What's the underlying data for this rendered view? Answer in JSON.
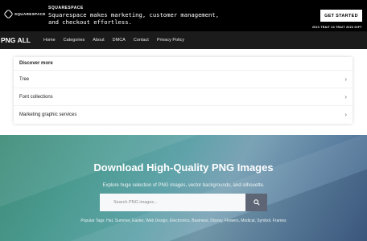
{
  "ad": {
    "logo_text": "SQUARESPACE",
    "brand": "SQUARESPACE",
    "message": "Squarespace makes marketing, customer management, and checkout effortless.",
    "cta": "GET STARTED",
    "footer": "2023 TRAIT 24 TRAIT 2023 GIFT"
  },
  "nav": {
    "site_title": "PNG ALL",
    "links": [
      "Home",
      "Categories",
      "About",
      "DMCA",
      "Contact",
      "Privacy Policy"
    ]
  },
  "discover": {
    "heading": "Discover more",
    "items": [
      "Tree",
      "Font collections",
      "Marketing graphic services"
    ]
  },
  "hero": {
    "title": "Download High-Quality PNG Images",
    "subtitle": "Explore huge selection of PNG images, vector backgrounds, and silhouette.",
    "search_placeholder": "Search PNG images...",
    "popular_tags": "Popular Tags: Hat, Summer, Easter, Web Design, Electronics, Business, Disney, Flowers, Medical, Symbol, Frames"
  },
  "icons": {
    "logo": "squarespace-logo-icon",
    "chevron": "chevron-right-icon",
    "search": "search-icon"
  }
}
